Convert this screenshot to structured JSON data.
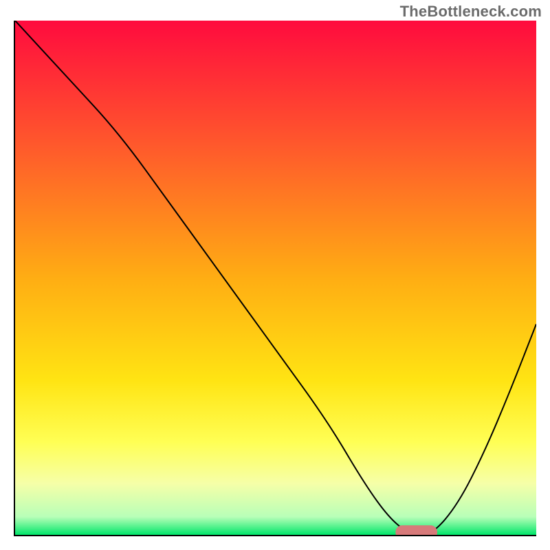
{
  "watermark": "TheBottleneck.com",
  "chart_data": {
    "type": "line",
    "title": "",
    "xlabel": "",
    "ylabel": "",
    "xlim": [
      0,
      100
    ],
    "ylim": [
      0,
      100
    ],
    "grid": false,
    "legend": null,
    "gradient_stops": [
      {
        "pos": 0.0,
        "color": "#ff0b3e"
      },
      {
        "pos": 0.25,
        "color": "#ff5b2b"
      },
      {
        "pos": 0.5,
        "color": "#ffad13"
      },
      {
        "pos": 0.7,
        "color": "#ffe413"
      },
      {
        "pos": 0.82,
        "color": "#ffff55"
      },
      {
        "pos": 0.9,
        "color": "#f6ffa8"
      },
      {
        "pos": 0.965,
        "color": "#b8ffb8"
      },
      {
        "pos": 1.0,
        "color": "#00e66a"
      }
    ],
    "series": [
      {
        "name": "bottleneck-curve",
        "color": "#000000",
        "x": [
          0,
          10,
          20,
          30,
          40,
          50,
          60,
          67,
          72,
          76,
          80,
          85,
          90,
          95,
          100
        ],
        "y": [
          100,
          89,
          78,
          64,
          50,
          36,
          22,
          10,
          3,
          0,
          0,
          6,
          16,
          28,
          41
        ]
      }
    ],
    "marker": {
      "name": "optimal-marker",
      "color": "#d77a7a",
      "x_start": 73,
      "x_end": 81,
      "y": 0.5,
      "thickness": 2.7
    }
  }
}
